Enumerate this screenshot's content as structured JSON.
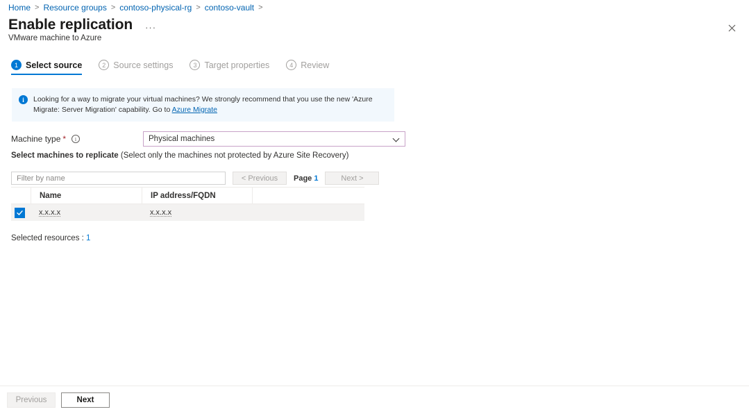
{
  "breadcrumb": {
    "items": [
      {
        "label": "Home"
      },
      {
        "label": "Resource groups"
      },
      {
        "label": "contoso-physical-rg"
      },
      {
        "label": "contoso-vault"
      }
    ],
    "separator": ">"
  },
  "header": {
    "title": "Enable replication",
    "subtitle": "VMware machine to Azure",
    "ellipsis": "···",
    "close_icon": "close-icon"
  },
  "steps": [
    {
      "number": "1",
      "label": "Select source",
      "state": "active"
    },
    {
      "number": "2",
      "label": "Source settings",
      "state": "inactive"
    },
    {
      "number": "3",
      "label": "Target properties",
      "state": "inactive"
    },
    {
      "number": "4",
      "label": "Review",
      "state": "inactive"
    }
  ],
  "banner": {
    "icon": "info-icon",
    "text_before": "Looking for a way to migrate your virtual machines? We strongly recommend that you use the new 'Azure Migrate: Server Migration' capability. Go to ",
    "link_label": "Azure Migrate",
    "background": "#f2f8fd",
    "accent": "#0078d4"
  },
  "machine_type": {
    "label": "Machine type",
    "required_marker": "*",
    "info_icon": "info-circle-icon",
    "selected_value": "Physical machines",
    "chevron_icon": "chevron-down-icon",
    "border_color": "#c8a2c8"
  },
  "section": {
    "heading_bold": "Select machines to replicate",
    "heading_rest": " (Select only the machines not protected by Azure Site Recovery)"
  },
  "filter": {
    "placeholder": "Filter by name",
    "value": "",
    "previous_label": "< Previous",
    "next_label": "Next >",
    "page_label": "Page",
    "page_number": "1"
  },
  "table": {
    "columns": [
      "",
      "Name",
      "IP address/FQDN",
      ""
    ],
    "rows": [
      {
        "checked": true,
        "name": "x.x.x.x",
        "ip": "x.x.x.x"
      }
    ]
  },
  "selected": {
    "label": "Selected resources : ",
    "count": "1"
  },
  "footer": {
    "previous_label": "Previous",
    "next_label": "Next"
  },
  "colors": {
    "azure_blue": "#0078d4",
    "link_blue": "#0063b1",
    "required_red": "#a4262c",
    "row_selected_bg": "#f3f2f1"
  }
}
